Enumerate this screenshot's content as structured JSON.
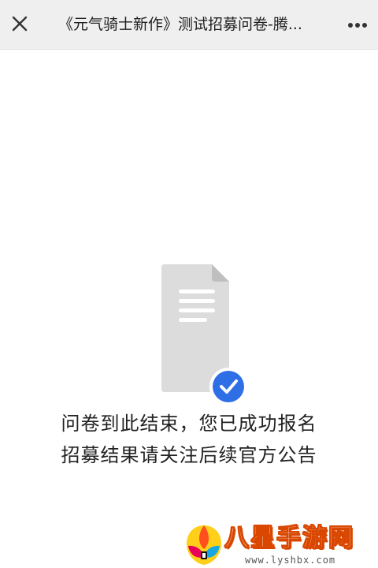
{
  "topbar": {
    "close_icon": "close-icon",
    "title": "《元气骑士新作》测试招募问卷-腾...",
    "more_icon": "more-icon"
  },
  "main": {
    "illustration_icon": "document-check-icon",
    "message_line1": "问卷到此结束，您已成功报名",
    "message_line2": "招募结果请关注后续官方公告"
  },
  "watermark": {
    "title": "八星手游网",
    "url": "www.lyshbx.com"
  },
  "colors": {
    "topbar_bg": "#efefef",
    "badge_blue": "#2f6fe6",
    "doc_gray": "#dedede",
    "watermark_orange": "#d94700"
  }
}
